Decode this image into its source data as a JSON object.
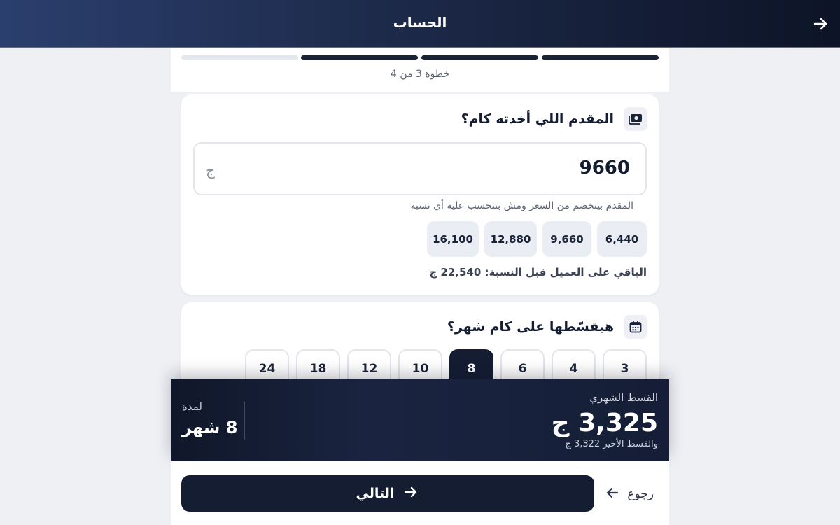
{
  "header": {
    "title": "الحساب",
    "back_icon": "arrow-right-icon"
  },
  "progress": {
    "current_step": 3,
    "total_steps": 4,
    "step_text": "خطوة 3 من 4"
  },
  "down_payment": {
    "title": "المقدم اللي أخدته كام؟",
    "icon": "money-icon",
    "value": "9660",
    "currency": "ج",
    "hint": "المقدم بيتخصم من السعر ومش بتتحسب عليه أي نسبة",
    "options": [
      "6,440",
      "9,660",
      "12,880",
      "16,100"
    ],
    "remaining": "الباقي على العميل قبل النسبة: 22,540 ج"
  },
  "installments": {
    "title": "هيقسّطها على كام شهر؟",
    "icon": "calendar-icon",
    "options": [
      "3",
      "4",
      "6",
      "8",
      "10",
      "12",
      "18",
      "24"
    ],
    "selected": "8"
  },
  "summary": {
    "monthly_label": "القسط الشهري",
    "monthly_value": "3,325 ج",
    "last_installment": "والقسط الأخير 3,322 ج",
    "duration_label": "لمدة",
    "duration_value": "8 شهر"
  },
  "actions": {
    "next_label": "التالي",
    "back_label": "رجوع"
  },
  "colors": {
    "primary": "#151d33",
    "chip_bg": "#eaedf4",
    "page_bg": "#eef0f4"
  }
}
